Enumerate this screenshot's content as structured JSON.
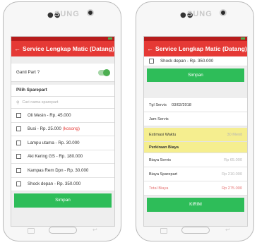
{
  "device": {
    "brand": "SUNG",
    "dots": "●●"
  },
  "left": {
    "appbar": {
      "back": "←",
      "title": "Service Lengkap Matic (Datang)"
    },
    "ganti_part": {
      "label": "Ganti Part ?"
    },
    "pilih_sparepart": "Pilih Sparepart",
    "search_placeholder": "Cari nama sparepart",
    "parts": [
      {
        "label": "Oli Mesin - Rp. 45.000",
        "note": ""
      },
      {
        "label": "Busi - Rp. 25.000",
        "note": "(kosong)"
      },
      {
        "label": "Lampu utama - Rp. 30.000",
        "note": ""
      },
      {
        "label": "Aki Kering GS - Rp. 180.000",
        "note": ""
      },
      {
        "label": "Kampas Rem Dpn - Rp. 30.000",
        "note": ""
      },
      {
        "label": "Shock depan - Rp. 350.000",
        "note": ""
      }
    ],
    "simpan_label": "Simpan"
  },
  "right": {
    "appbar": {
      "back": "←",
      "title": "Service Lengkap Matic (Datang)"
    },
    "top_part": {
      "label": "Shock depan - Rp. 350.000"
    },
    "simpan_label": "Simpan",
    "tgl_servis": {
      "label": "Tgl Servis",
      "value": "03/02/2018"
    },
    "jam_servis": {
      "label": "Jam Servis",
      "value": ""
    },
    "estimasi": {
      "label": "Estimasi Waktu",
      "value": "30 Menit"
    },
    "perkiraan_biaya": "Perkiraan Biaya",
    "biaya_servis": {
      "label": "Biaya Servis",
      "value": "Rp 65.000"
    },
    "biaya_sparepart": {
      "label": "Biaya Sparepart",
      "value": "Rp 210.000"
    },
    "total_biaya": {
      "label": "Total Biaya",
      "value": "Rp 275.000"
    },
    "kirim_label": "KIRIM"
  },
  "colors": {
    "appbar": "#e53935",
    "statusbar": "#b71c1c",
    "button": "#2ebd59",
    "toggle_on": "#4caf50",
    "highlight": "#f5ee8f",
    "warning": "#e53935"
  },
  "icons": {
    "back": "arrow-left-icon",
    "search": "search-icon",
    "toggle": "toggle-switch-icon",
    "checkbox": "checkbox-icon"
  }
}
